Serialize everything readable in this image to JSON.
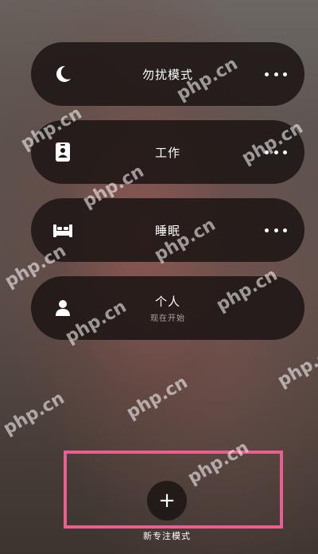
{
  "focus_modes": [
    {
      "name": "勿扰模式",
      "icon": "moon-icon",
      "subtitle": "",
      "has_more": true
    },
    {
      "name": "工作",
      "icon": "id-badge-icon",
      "subtitle": "",
      "has_more": true
    },
    {
      "name": "睡眠",
      "icon": "bed-icon",
      "subtitle": "",
      "has_more": true
    },
    {
      "name": "个人",
      "icon": "person-icon",
      "subtitle": "现在开始",
      "has_more": false
    }
  ],
  "new_focus": {
    "label": "新专注模式",
    "icon": "plus-icon",
    "symbol": "+"
  },
  "watermark": {
    "text": "php.cn"
  },
  "colors": {
    "pill_background": "#1c1614",
    "highlight": "#e8608f",
    "text": "#ffffff"
  }
}
